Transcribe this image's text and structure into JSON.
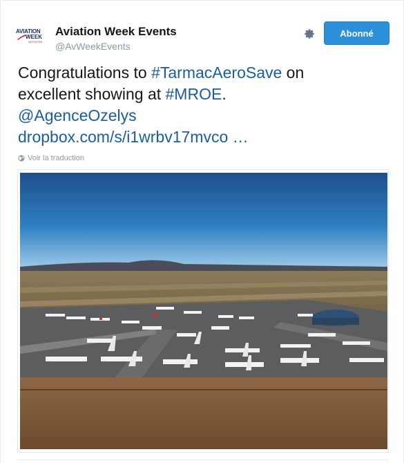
{
  "account": {
    "logo_text_line1": "AVIATION",
    "logo_text_line2": "WEEK",
    "logo_text_line3": "NETWORK",
    "name": "Aviation Week Events",
    "handle": "@AvWeekEvents"
  },
  "actions": {
    "settings_icon": "gear-icon",
    "follow_label": "Abonné"
  },
  "tweet": {
    "text_part1": "Congratulations to ",
    "hashtag1": "#TarmacAeroSave",
    "text_part2": " on",
    "text_part3": "excellent showing at ",
    "hashtag2": "#MROE",
    "text_part4": ".",
    "mention": "@AgenceOzelys",
    "url": "dropbox.com/s/i1wrbv17mvco",
    "ellipsis": " …"
  },
  "translate": {
    "icon": "globe-icon",
    "label": "Voir la traduction"
  },
  "colors": {
    "link": "#1b5da0",
    "follow_button": "#2b90d9",
    "muted": "#8899a6"
  }
}
